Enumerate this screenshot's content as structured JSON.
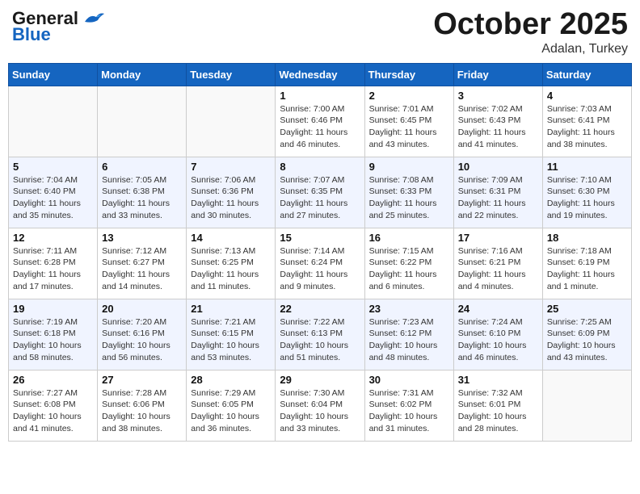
{
  "header": {
    "logo_line1": "General",
    "logo_line2": "Blue",
    "month_title": "October 2025",
    "location": "Adalan, Turkey"
  },
  "days_of_week": [
    "Sunday",
    "Monday",
    "Tuesday",
    "Wednesday",
    "Thursday",
    "Friday",
    "Saturday"
  ],
  "weeks": [
    [
      {
        "day": "",
        "sunrise": "",
        "sunset": "",
        "daylight": ""
      },
      {
        "day": "",
        "sunrise": "",
        "sunset": "",
        "daylight": ""
      },
      {
        "day": "",
        "sunrise": "",
        "sunset": "",
        "daylight": ""
      },
      {
        "day": "1",
        "sunrise": "Sunrise: 7:00 AM",
        "sunset": "Sunset: 6:46 PM",
        "daylight": "Daylight: 11 hours and 46 minutes."
      },
      {
        "day": "2",
        "sunrise": "Sunrise: 7:01 AM",
        "sunset": "Sunset: 6:45 PM",
        "daylight": "Daylight: 11 hours and 43 minutes."
      },
      {
        "day": "3",
        "sunrise": "Sunrise: 7:02 AM",
        "sunset": "Sunset: 6:43 PM",
        "daylight": "Daylight: 11 hours and 41 minutes."
      },
      {
        "day": "4",
        "sunrise": "Sunrise: 7:03 AM",
        "sunset": "Sunset: 6:41 PM",
        "daylight": "Daylight: 11 hours and 38 minutes."
      }
    ],
    [
      {
        "day": "5",
        "sunrise": "Sunrise: 7:04 AM",
        "sunset": "Sunset: 6:40 PM",
        "daylight": "Daylight: 11 hours and 35 minutes."
      },
      {
        "day": "6",
        "sunrise": "Sunrise: 7:05 AM",
        "sunset": "Sunset: 6:38 PM",
        "daylight": "Daylight: 11 hours and 33 minutes."
      },
      {
        "day": "7",
        "sunrise": "Sunrise: 7:06 AM",
        "sunset": "Sunset: 6:36 PM",
        "daylight": "Daylight: 11 hours and 30 minutes."
      },
      {
        "day": "8",
        "sunrise": "Sunrise: 7:07 AM",
        "sunset": "Sunset: 6:35 PM",
        "daylight": "Daylight: 11 hours and 27 minutes."
      },
      {
        "day": "9",
        "sunrise": "Sunrise: 7:08 AM",
        "sunset": "Sunset: 6:33 PM",
        "daylight": "Daylight: 11 hours and 25 minutes."
      },
      {
        "day": "10",
        "sunrise": "Sunrise: 7:09 AM",
        "sunset": "Sunset: 6:31 PM",
        "daylight": "Daylight: 11 hours and 22 minutes."
      },
      {
        "day": "11",
        "sunrise": "Sunrise: 7:10 AM",
        "sunset": "Sunset: 6:30 PM",
        "daylight": "Daylight: 11 hours and 19 minutes."
      }
    ],
    [
      {
        "day": "12",
        "sunrise": "Sunrise: 7:11 AM",
        "sunset": "Sunset: 6:28 PM",
        "daylight": "Daylight: 11 hours and 17 minutes."
      },
      {
        "day": "13",
        "sunrise": "Sunrise: 7:12 AM",
        "sunset": "Sunset: 6:27 PM",
        "daylight": "Daylight: 11 hours and 14 minutes."
      },
      {
        "day": "14",
        "sunrise": "Sunrise: 7:13 AM",
        "sunset": "Sunset: 6:25 PM",
        "daylight": "Daylight: 11 hours and 11 minutes."
      },
      {
        "day": "15",
        "sunrise": "Sunrise: 7:14 AM",
        "sunset": "Sunset: 6:24 PM",
        "daylight": "Daylight: 11 hours and 9 minutes."
      },
      {
        "day": "16",
        "sunrise": "Sunrise: 7:15 AM",
        "sunset": "Sunset: 6:22 PM",
        "daylight": "Daylight: 11 hours and 6 minutes."
      },
      {
        "day": "17",
        "sunrise": "Sunrise: 7:16 AM",
        "sunset": "Sunset: 6:21 PM",
        "daylight": "Daylight: 11 hours and 4 minutes."
      },
      {
        "day": "18",
        "sunrise": "Sunrise: 7:18 AM",
        "sunset": "Sunset: 6:19 PM",
        "daylight": "Daylight: 11 hours and 1 minute."
      }
    ],
    [
      {
        "day": "19",
        "sunrise": "Sunrise: 7:19 AM",
        "sunset": "Sunset: 6:18 PM",
        "daylight": "Daylight: 10 hours and 58 minutes."
      },
      {
        "day": "20",
        "sunrise": "Sunrise: 7:20 AM",
        "sunset": "Sunset: 6:16 PM",
        "daylight": "Daylight: 10 hours and 56 minutes."
      },
      {
        "day": "21",
        "sunrise": "Sunrise: 7:21 AM",
        "sunset": "Sunset: 6:15 PM",
        "daylight": "Daylight: 10 hours and 53 minutes."
      },
      {
        "day": "22",
        "sunrise": "Sunrise: 7:22 AM",
        "sunset": "Sunset: 6:13 PM",
        "daylight": "Daylight: 10 hours and 51 minutes."
      },
      {
        "day": "23",
        "sunrise": "Sunrise: 7:23 AM",
        "sunset": "Sunset: 6:12 PM",
        "daylight": "Daylight: 10 hours and 48 minutes."
      },
      {
        "day": "24",
        "sunrise": "Sunrise: 7:24 AM",
        "sunset": "Sunset: 6:10 PM",
        "daylight": "Daylight: 10 hours and 46 minutes."
      },
      {
        "day": "25",
        "sunrise": "Sunrise: 7:25 AM",
        "sunset": "Sunset: 6:09 PM",
        "daylight": "Daylight: 10 hours and 43 minutes."
      }
    ],
    [
      {
        "day": "26",
        "sunrise": "Sunrise: 7:27 AM",
        "sunset": "Sunset: 6:08 PM",
        "daylight": "Daylight: 10 hours and 41 minutes."
      },
      {
        "day": "27",
        "sunrise": "Sunrise: 7:28 AM",
        "sunset": "Sunset: 6:06 PM",
        "daylight": "Daylight: 10 hours and 38 minutes."
      },
      {
        "day": "28",
        "sunrise": "Sunrise: 7:29 AM",
        "sunset": "Sunset: 6:05 PM",
        "daylight": "Daylight: 10 hours and 36 minutes."
      },
      {
        "day": "29",
        "sunrise": "Sunrise: 7:30 AM",
        "sunset": "Sunset: 6:04 PM",
        "daylight": "Daylight: 10 hours and 33 minutes."
      },
      {
        "day": "30",
        "sunrise": "Sunrise: 7:31 AM",
        "sunset": "Sunset: 6:02 PM",
        "daylight": "Daylight: 10 hours and 31 minutes."
      },
      {
        "day": "31",
        "sunrise": "Sunrise: 7:32 AM",
        "sunset": "Sunset: 6:01 PM",
        "daylight": "Daylight: 10 hours and 28 minutes."
      },
      {
        "day": "",
        "sunrise": "",
        "sunset": "",
        "daylight": ""
      }
    ]
  ]
}
